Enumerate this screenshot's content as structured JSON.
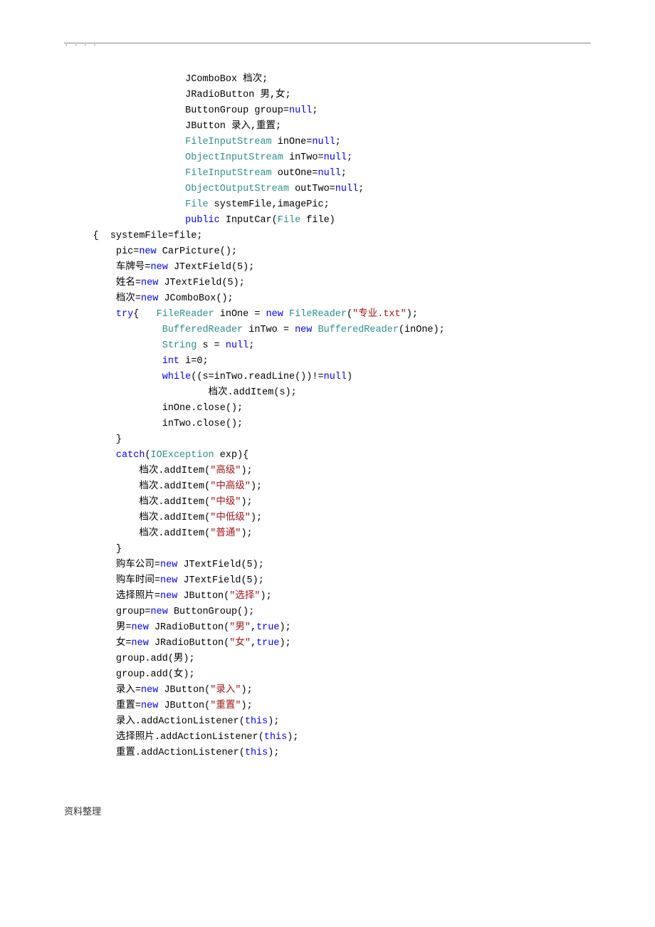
{
  "header_rule_dots": ".                .           .                    .",
  "code_lines": [
    {
      "indent": 4,
      "tokens": [
        {
          "t": "JComboBox 档次;",
          "c": ""
        }
      ]
    },
    {
      "indent": 4,
      "tokens": [
        {
          "t": "JRadioButton 男,女;",
          "c": ""
        }
      ]
    },
    {
      "indent": 4,
      "tokens": [
        {
          "t": "ButtonGroup group=",
          "c": ""
        },
        {
          "t": "null",
          "c": "kw"
        },
        {
          "t": ";",
          "c": ""
        }
      ]
    },
    {
      "indent": 4,
      "tokens": [
        {
          "t": "JButton 录入,重置;",
          "c": ""
        }
      ]
    },
    {
      "indent": 4,
      "tokens": [
        {
          "t": "FileInputStream",
          "c": "type"
        },
        {
          "t": " inOne=",
          "c": ""
        },
        {
          "t": "null",
          "c": "kw"
        },
        {
          "t": ";",
          "c": ""
        }
      ]
    },
    {
      "indent": 4,
      "tokens": [
        {
          "t": "ObjectInputStream",
          "c": "type"
        },
        {
          "t": " inTwo=",
          "c": ""
        },
        {
          "t": "null",
          "c": "kw"
        },
        {
          "t": ";",
          "c": ""
        }
      ]
    },
    {
      "indent": 4,
      "tokens": [
        {
          "t": "FileInputStream",
          "c": "type"
        },
        {
          "t": " outOne=",
          "c": ""
        },
        {
          "t": "null",
          "c": "kw"
        },
        {
          "t": ";",
          "c": ""
        }
      ]
    },
    {
      "indent": 4,
      "tokens": [
        {
          "t": "ObjectOutputStream",
          "c": "type"
        },
        {
          "t": " outTwo=",
          "c": ""
        },
        {
          "t": "null",
          "c": "kw"
        },
        {
          "t": ";",
          "c": ""
        }
      ]
    },
    {
      "indent": 4,
      "tokens": [
        {
          "t": "File",
          "c": "type"
        },
        {
          "t": " systemFile,imagePic;",
          "c": ""
        }
      ]
    },
    {
      "indent": 4,
      "tokens": [
        {
          "t": "public",
          "c": "kw"
        },
        {
          "t": " InputCar(",
          "c": ""
        },
        {
          "t": "File",
          "c": "type"
        },
        {
          "t": " file)",
          "c": ""
        }
      ]
    },
    {
      "indent": 0,
      "tokens": [
        {
          "t": "{  systemFile=file;",
          "c": ""
        }
      ]
    },
    {
      "indent": 1,
      "tokens": [
        {
          "t": "pic=",
          "c": ""
        },
        {
          "t": "new",
          "c": "kw"
        },
        {
          "t": " CarPicture();",
          "c": ""
        }
      ]
    },
    {
      "indent": 1,
      "tokens": [
        {
          "t": "车牌号=",
          "c": ""
        },
        {
          "t": "new",
          "c": "kw"
        },
        {
          "t": " JTextField(5);",
          "c": ""
        }
      ]
    },
    {
      "indent": 1,
      "tokens": [
        {
          "t": "姓名=",
          "c": ""
        },
        {
          "t": "new",
          "c": "kw"
        },
        {
          "t": " JTextField(5);",
          "c": ""
        }
      ]
    },
    {
      "indent": 1,
      "tokens": [
        {
          "t": "档次=",
          "c": ""
        },
        {
          "t": "new",
          "c": "kw"
        },
        {
          "t": " JComboBox();",
          "c": ""
        }
      ]
    },
    {
      "indent": 1,
      "tokens": [
        {
          "t": "try",
          "c": "kw"
        },
        {
          "t": "{   ",
          "c": ""
        },
        {
          "t": "FileReader",
          "c": "type"
        },
        {
          "t": " inOne = ",
          "c": ""
        },
        {
          "t": "new",
          "c": "kw"
        },
        {
          "t": " ",
          "c": ""
        },
        {
          "t": "FileReader",
          "c": "type"
        },
        {
          "t": "(",
          "c": ""
        },
        {
          "t": "\"专业.txt\"",
          "c": "str"
        },
        {
          "t": ");",
          "c": ""
        }
      ]
    },
    {
      "indent": 3,
      "tokens": [
        {
          "t": "BufferedReader",
          "c": "type"
        },
        {
          "t": " inTwo = ",
          "c": ""
        },
        {
          "t": "new",
          "c": "kw"
        },
        {
          "t": " ",
          "c": ""
        },
        {
          "t": "BufferedReader",
          "c": "type"
        },
        {
          "t": "(inOne);",
          "c": ""
        }
      ]
    },
    {
      "indent": 3,
      "tokens": [
        {
          "t": "String",
          "c": "type"
        },
        {
          "t": " s = ",
          "c": ""
        },
        {
          "t": "null",
          "c": "kw"
        },
        {
          "t": ";",
          "c": ""
        }
      ]
    },
    {
      "indent": 3,
      "tokens": [
        {
          "t": "int",
          "c": "kw"
        },
        {
          "t": " i=0;",
          "c": ""
        }
      ]
    },
    {
      "indent": 3,
      "tokens": [
        {
          "t": "while",
          "c": "kw"
        },
        {
          "t": "((s=inTwo.readLine())!=",
          "c": ""
        },
        {
          "t": "null",
          "c": "kw"
        },
        {
          "t": ")",
          "c": ""
        }
      ]
    },
    {
      "indent": 5,
      "tokens": [
        {
          "t": "档次.addItem(s);",
          "c": ""
        }
      ]
    },
    {
      "indent": 3,
      "tokens": [
        {
          "t": "inOne.close();",
          "c": ""
        }
      ]
    },
    {
      "indent": 3,
      "tokens": [
        {
          "t": "inTwo.close();",
          "c": ""
        }
      ]
    },
    {
      "indent": 1,
      "tokens": [
        {
          "t": "}",
          "c": ""
        }
      ]
    },
    {
      "indent": 1,
      "tokens": [
        {
          "t": "catch",
          "c": "kw"
        },
        {
          "t": "(",
          "c": ""
        },
        {
          "t": "IOException",
          "c": "type"
        },
        {
          "t": " exp){",
          "c": ""
        }
      ]
    },
    {
      "indent": 2,
      "tokens": [
        {
          "t": "档次.addItem(",
          "c": ""
        },
        {
          "t": "\"高级\"",
          "c": "str"
        },
        {
          "t": ");",
          "c": ""
        }
      ]
    },
    {
      "indent": 2,
      "tokens": [
        {
          "t": "档次.addItem(",
          "c": ""
        },
        {
          "t": "\"中高级\"",
          "c": "str"
        },
        {
          "t": ");",
          "c": ""
        }
      ]
    },
    {
      "indent": 2,
      "tokens": [
        {
          "t": "档次.addItem(",
          "c": ""
        },
        {
          "t": "\"中级\"",
          "c": "str"
        },
        {
          "t": ");",
          "c": ""
        }
      ]
    },
    {
      "indent": 2,
      "tokens": [
        {
          "t": "档次.addItem(",
          "c": ""
        },
        {
          "t": "\"中低级\"",
          "c": "str"
        },
        {
          "t": ");",
          "c": ""
        }
      ]
    },
    {
      "indent": 2,
      "tokens": [
        {
          "t": "档次.addItem(",
          "c": ""
        },
        {
          "t": "\"普通\"",
          "c": "str"
        },
        {
          "t": ");",
          "c": ""
        }
      ]
    },
    {
      "indent": 1,
      "tokens": [
        {
          "t": "}",
          "c": ""
        }
      ]
    },
    {
      "indent": 1,
      "tokens": [
        {
          "t": "购车公司=",
          "c": ""
        },
        {
          "t": "new",
          "c": "kw"
        },
        {
          "t": " JTextField(5);",
          "c": ""
        }
      ]
    },
    {
      "indent": 1,
      "tokens": [
        {
          "t": "购车时间=",
          "c": ""
        },
        {
          "t": "new",
          "c": "kw"
        },
        {
          "t": " JTextField(5);",
          "c": ""
        }
      ]
    },
    {
      "indent": 1,
      "tokens": [
        {
          "t": "选择照片=",
          "c": ""
        },
        {
          "t": "new",
          "c": "kw"
        },
        {
          "t": " JButton(",
          "c": ""
        },
        {
          "t": "\"选择\"",
          "c": "str"
        },
        {
          "t": ");",
          "c": ""
        }
      ]
    },
    {
      "indent": 1,
      "tokens": [
        {
          "t": "group=",
          "c": ""
        },
        {
          "t": "new",
          "c": "kw"
        },
        {
          "t": " ButtonGroup();",
          "c": ""
        }
      ]
    },
    {
      "indent": 1,
      "tokens": [
        {
          "t": "男=",
          "c": ""
        },
        {
          "t": "new",
          "c": "kw"
        },
        {
          "t": " JRadioButton(",
          "c": ""
        },
        {
          "t": "\"男\"",
          "c": "str"
        },
        {
          "t": ",",
          "c": ""
        },
        {
          "t": "true",
          "c": "kw"
        },
        {
          "t": ");",
          "c": ""
        }
      ]
    },
    {
      "indent": 1,
      "tokens": [
        {
          "t": "女=",
          "c": ""
        },
        {
          "t": "new",
          "c": "kw"
        },
        {
          "t": " JRadioButton(",
          "c": ""
        },
        {
          "t": "\"女\"",
          "c": "str"
        },
        {
          "t": ",",
          "c": ""
        },
        {
          "t": "true",
          "c": "kw"
        },
        {
          "t": ");",
          "c": ""
        }
      ]
    },
    {
      "indent": 1,
      "tokens": [
        {
          "t": "group.add(男);",
          "c": ""
        }
      ]
    },
    {
      "indent": 1,
      "tokens": [
        {
          "t": "group.add(女);",
          "c": ""
        }
      ]
    },
    {
      "indent": 1,
      "tokens": [
        {
          "t": "录入=",
          "c": ""
        },
        {
          "t": "new",
          "c": "kw"
        },
        {
          "t": " JButton(",
          "c": ""
        },
        {
          "t": "\"录入\"",
          "c": "str"
        },
        {
          "t": ");",
          "c": ""
        }
      ]
    },
    {
      "indent": 1,
      "tokens": [
        {
          "t": "重置=",
          "c": ""
        },
        {
          "t": "new",
          "c": "kw"
        },
        {
          "t": " JButton(",
          "c": ""
        },
        {
          "t": "\"重置\"",
          "c": "str"
        },
        {
          "t": ");",
          "c": ""
        }
      ]
    },
    {
      "indent": 1,
      "tokens": [
        {
          "t": "录入.addActionListener(",
          "c": ""
        },
        {
          "t": "this",
          "c": "kw"
        },
        {
          "t": ");",
          "c": ""
        }
      ]
    },
    {
      "indent": 1,
      "tokens": [
        {
          "t": "选择照片.addActionListener(",
          "c": ""
        },
        {
          "t": "this",
          "c": "kw"
        },
        {
          "t": ");",
          "c": ""
        }
      ]
    },
    {
      "indent": 1,
      "tokens": [
        {
          "t": "重置.addActionListener(",
          "c": ""
        },
        {
          "t": "this",
          "c": "kw"
        },
        {
          "t": ");",
          "c": ""
        }
      ]
    }
  ],
  "indent_unit": "    ",
  "base_indent": "     ",
  "footer": "资料整理"
}
